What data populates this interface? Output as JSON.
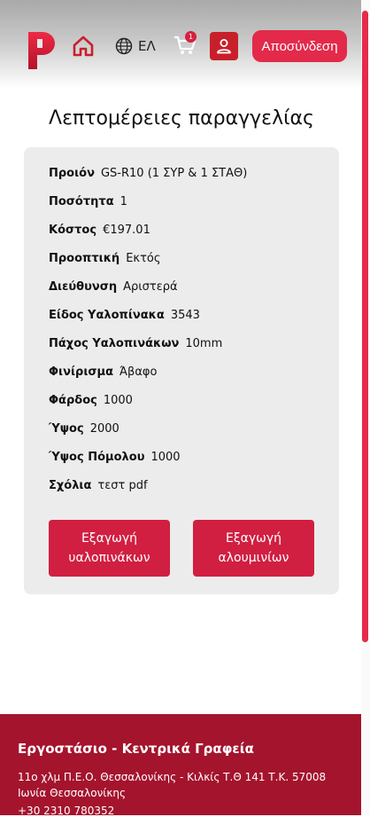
{
  "header": {
    "language_label": "ΕΛ",
    "cart_count": "1",
    "logout_label": "Αποσύνδεση"
  },
  "page": {
    "title": "Λεπτομέρειες παραγγελίας"
  },
  "order": {
    "rows": [
      {
        "label": "Προιόν",
        "value": "GS-R10 (1 ΣΥΡ & 1 ΣΤΑΘ)"
      },
      {
        "label": "Ποσότητα",
        "value": "1"
      },
      {
        "label": "Κόστος",
        "value": "€197.01"
      },
      {
        "label": "Προοπτική",
        "value": "Εκτός"
      },
      {
        "label": "Διεύθυνση",
        "value": "Αριστερά"
      },
      {
        "label": "Είδος Υαλοπίνακα",
        "value": "3543"
      },
      {
        "label": "Πάχος Υαλοπινάκων",
        "value": "10mm"
      },
      {
        "label": "Φινίρισμα",
        "value": "Άβαφο"
      },
      {
        "label": "Φάρδος",
        "value": "1000"
      },
      {
        "label": "Ύψος",
        "value": "2000"
      },
      {
        "label": "Ύψος Πόμολου",
        "value": "1000"
      },
      {
        "label": "Σχόλια",
        "value": "τεστ pdf"
      }
    ],
    "export_glass_line1": "Εξαγωγή",
    "export_glass_line2": "υαλοπινάκων",
    "export_aluminum_line1": "Εξαγωγή",
    "export_aluminum_line2": "αλουμινίων"
  },
  "footer": {
    "title": "Εργοστάσιο - Κεντρικά Γραφεία",
    "address": "11ο χλμ Π.Ε.Ο. Θεσσαλονίκης - Κιλκίς Τ.Θ 141 Τ.Κ. 57008 Ιωνία Θεσσαλονίκης",
    "phone": "+30 2310 780352"
  },
  "colors": {
    "accent": "#d11f41",
    "footer_bg": "#a4142d",
    "card_bg": "#ececec"
  }
}
